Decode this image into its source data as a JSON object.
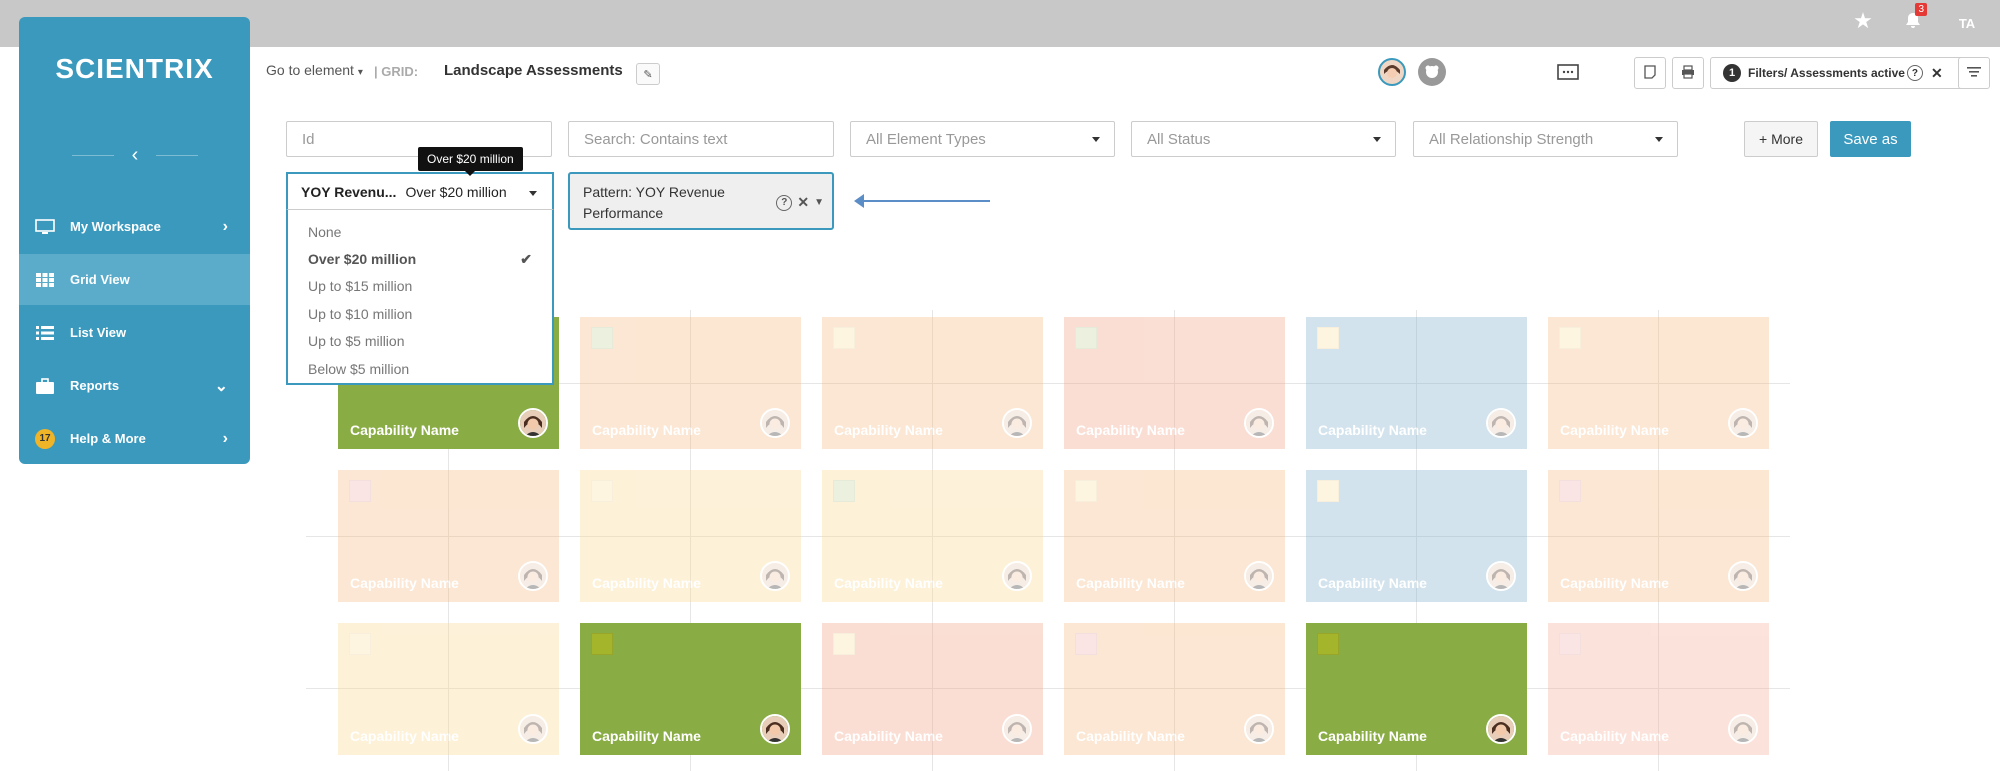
{
  "topbar": {
    "star_icon": "star-icon",
    "bell_icon": "bell-icon",
    "notification_count": "3",
    "user_initials": "TA"
  },
  "sidebar": {
    "logo": "SCIENTRIX",
    "collapse_icon": "chevron-left-icon",
    "items": [
      {
        "label": "My Workspace",
        "icon": "monitor-icon"
      },
      {
        "label": "Grid View",
        "icon": "grid-icon"
      },
      {
        "label": "List View",
        "icon": "list-icon"
      },
      {
        "label": "Reports",
        "icon": "briefcase-icon"
      },
      {
        "label": "Help & More",
        "badge": "17"
      }
    ]
  },
  "header": {
    "goto_label": "Go to element",
    "grid_prefix": "| GRID:",
    "title": "Landscape Assessments",
    "filters_count": "1",
    "filters_label": "Filters/ Assessments active"
  },
  "filters": {
    "id_placeholder": "Id",
    "search_placeholder": "Search: Contains text",
    "element_types": "All Element Types",
    "status": "All Status",
    "relationship": "All Relationship Strength",
    "more_label": "+ More",
    "saveas_label": "Save as"
  },
  "yoy_filter": {
    "label": "YOY Revenu...",
    "value": "Over $20 million",
    "tooltip": "Over $20 million",
    "options": [
      "None",
      "Over $20 million",
      "Up to $15 million",
      "Up to $10 million",
      "Up to $5 million",
      "Below $5 million"
    ],
    "selected_index": 1
  },
  "pattern": {
    "text": "Pattern: YOY Revenue Performance"
  },
  "grid": {
    "card_label": "Capability Name",
    "colors": {
      "green": "#8aac44",
      "orange": "#f5bb82",
      "yellow": "#fbd891",
      "salmon": "#f2a286",
      "blue": "#7fb0cc",
      "pink": "#f5b09a"
    },
    "rows": [
      [
        {
          "color": "green",
          "sq": "#b9c24f",
          "active": true
        },
        {
          "color": "orange",
          "sq": "#c8d9a2"
        },
        {
          "color": "orange",
          "sq": "#fde5a8"
        },
        {
          "color": "salmon",
          "sq": "#c8d9a2"
        },
        {
          "color": "blue",
          "sq": "#fde5a8"
        },
        {
          "color": "orange",
          "sq": "#fde5a8"
        }
      ],
      [
        {
          "color": "orange",
          "sq": "#f6b3b3"
        },
        {
          "color": "yellow",
          "sq": "#fde5a8"
        },
        {
          "color": "yellow",
          "sq": "#c8d9a2"
        },
        {
          "color": "orange",
          "sq": "#fde5a8"
        },
        {
          "color": "blue",
          "sq": "#fde5a8"
        },
        {
          "color": "orange",
          "sq": "#f6b3b3"
        }
      ],
      [
        {
          "color": "yellow",
          "sq": "#fde5a8"
        },
        {
          "color": "green",
          "sq": "#a4b52c",
          "active": true
        },
        {
          "color": "salmon",
          "sq": "#fde5a8"
        },
        {
          "color": "orange",
          "sq": "#f6b3b3"
        },
        {
          "color": "green",
          "sq": "#a4b52c",
          "active": true
        },
        {
          "color": "pink",
          "sq": "#f6b3b3"
        }
      ]
    ]
  }
}
